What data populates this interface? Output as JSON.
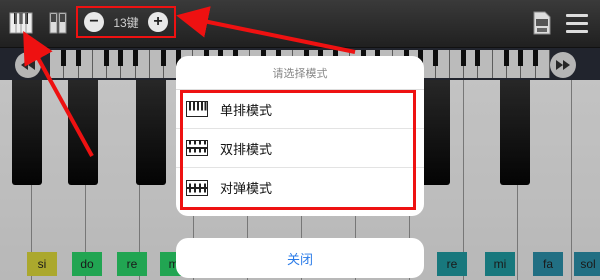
{
  "toolbar": {
    "key_count": "13键",
    "decrement": "−",
    "increment": "+",
    "md_icon": "md-file-icon",
    "menu_icon": "hamburger-menu-icon"
  },
  "mode_dialog": {
    "title": "请选择模式",
    "options": [
      {
        "label": "单排模式",
        "icon": "single-row-keyboard-icon"
      },
      {
        "label": "双排模式",
        "icon": "double-row-keyboard-icon"
      },
      {
        "label": "对弹模式",
        "icon": "duet-keyboard-icon"
      }
    ],
    "close_label": "关闭"
  },
  "note_labels": [
    "si",
    "do",
    "re",
    "mi",
    "re",
    "mi",
    "fa",
    "sol"
  ],
  "colors": {
    "annotation": "#ee1111",
    "accent": "#2a7be8",
    "note_green": "#2bd46a",
    "note_yellow": "#dcd83a",
    "note_teal": "#1f9aa0",
    "note_blue_teal": "#2b8fa8"
  }
}
